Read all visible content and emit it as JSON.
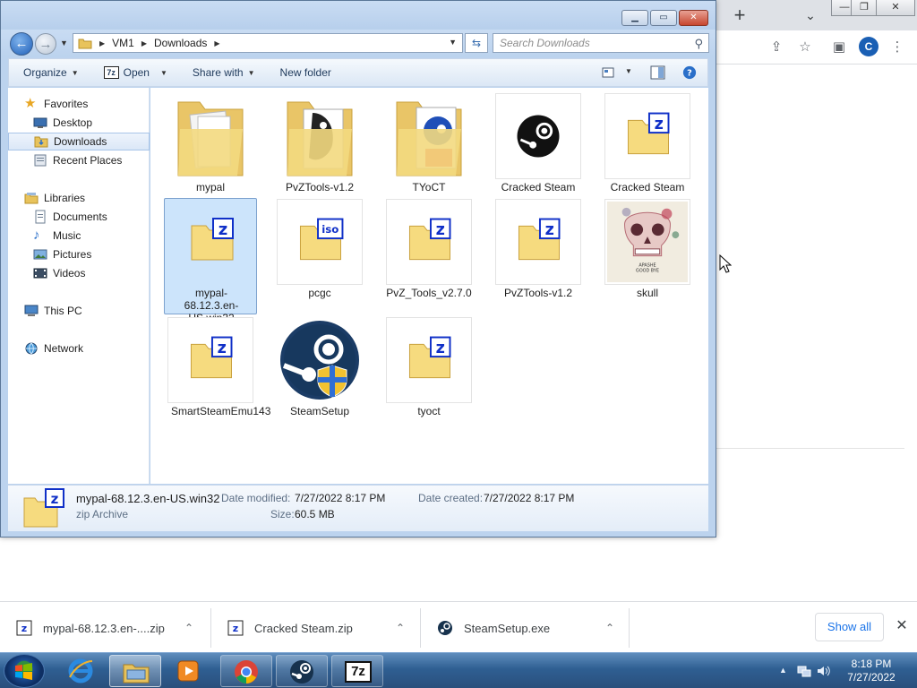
{
  "explorer": {
    "breadcrumb": [
      "VM1",
      "Downloads"
    ],
    "search_placeholder": "Search Downloads",
    "commands": [
      "Organize",
      "Open",
      "Share with",
      "New folder"
    ],
    "nav_pane": {
      "favorites_header": "Favorites",
      "favorites": [
        "Desktop",
        "Downloads",
        "Recent Places"
      ],
      "libraries_header": "Libraries",
      "libraries": [
        "Documents",
        "Music",
        "Pictures",
        "Videos"
      ],
      "this_pc": "This PC",
      "network": "Network"
    },
    "items": [
      {
        "label": "mypal",
        "type": "folder"
      },
      {
        "label": "PvZTools-v1.2",
        "type": "folder"
      },
      {
        "label": "TYoCT",
        "type": "folder"
      },
      {
        "label": "Cracked Steam",
        "type": "steam-app"
      },
      {
        "label": "Cracked Steam",
        "type": "zip"
      },
      {
        "label": "mypal-68.12.3.en-US.win32",
        "type": "zip",
        "selected": true
      },
      {
        "label": "pcgc",
        "type": "iso"
      },
      {
        "label": "PvZ_Tools_v2.7.0",
        "type": "zip"
      },
      {
        "label": "PvZTools-v1.2",
        "type": "zip"
      },
      {
        "label": "skull",
        "type": "image"
      },
      {
        "label": "SmartSteamEmu143",
        "type": "zip"
      },
      {
        "label": "SteamSetup",
        "type": "steam-installer"
      },
      {
        "label": "tyoct",
        "type": "zip"
      }
    ],
    "details": {
      "name": "mypal-68.12.3.en-US.win32",
      "type": "zip Archive",
      "modified_label": "Date modified:",
      "modified": "7/27/2022 8:17 PM",
      "created_label": "Date created:",
      "created": "7/27/2022 8:17 PM",
      "size_label": "Size:",
      "size": "60.5 MB"
    }
  },
  "downloads_shelf": {
    "items": [
      {
        "name": "mypal-68.12.3.en-....zip"
      },
      {
        "name": "Cracked Steam.zip"
      },
      {
        "name": "SteamSetup.exe"
      }
    ],
    "show_all": "Show all"
  },
  "browser": {
    "avatar_letter": "C"
  },
  "taskbar": {
    "time": "8:18 PM",
    "date": "7/27/2022"
  },
  "colors": {
    "selection": "#cce4fb",
    "chrome_accent": "#1a73e8",
    "zip_blue": "#1030c8",
    "folder_yellow": "#f4d77a"
  }
}
